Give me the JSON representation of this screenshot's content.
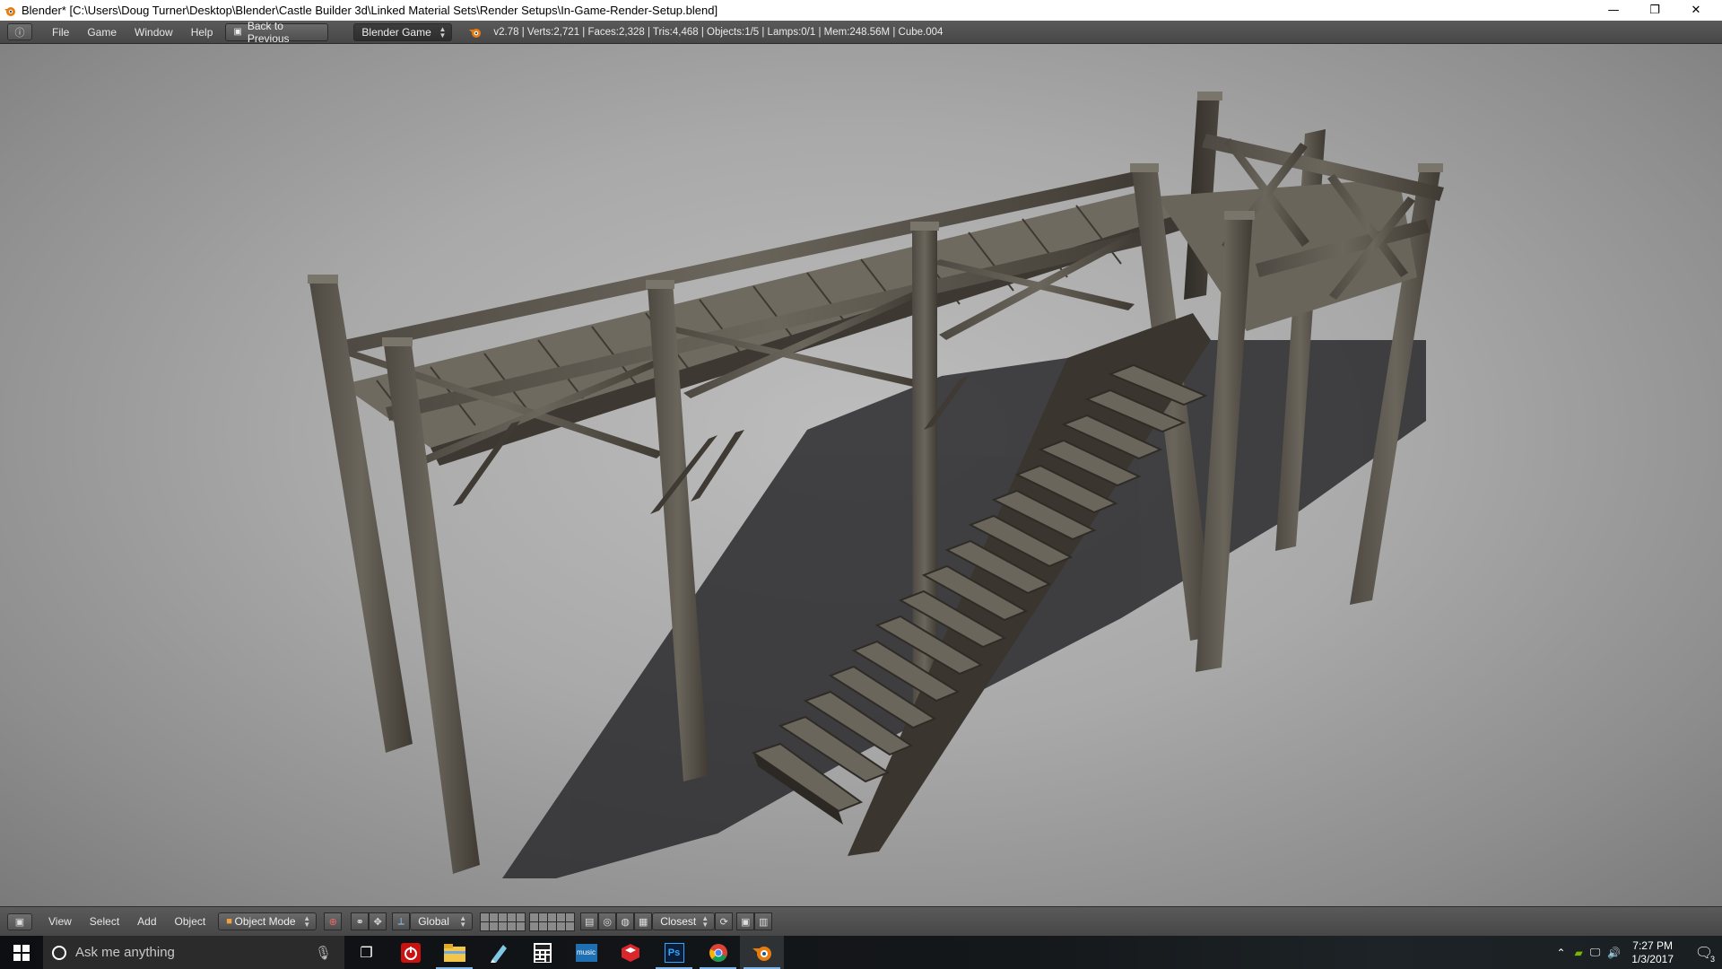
{
  "window": {
    "title": "Blender* [C:\\Users\\Doug Turner\\Desktop\\Blender\\Castle Builder 3d\\Linked Material Sets\\Render Setups\\In-Game-Render-Setup.blend]",
    "minimize_glyph": "—",
    "maximize_glyph": "❐",
    "close_glyph": "✕"
  },
  "info_header": {
    "menus": [
      "File",
      "Game",
      "Window",
      "Help"
    ],
    "back_button": "Back to Previous",
    "engine": "Blender Game",
    "stats": "v2.78 | Verts:2,721 | Faces:2,328 | Tris:4,468 | Objects:1/5 | Lamps:0/1 | Mem:248.56M | Cube.004"
  },
  "viewport": {
    "object": "wooden-walkway-with-stairs",
    "background_color": "#a9a9a9",
    "wood_color": "#5a554c"
  },
  "view_header": {
    "menus": [
      "View",
      "Select",
      "Add",
      "Object"
    ],
    "mode": "Object Mode",
    "orientation": "Global",
    "snap_target": "Closest"
  },
  "taskbar": {
    "search_placeholder": "Ask me anything",
    "apps": [
      "task-view",
      "power",
      "file-explorer",
      "notes",
      "calculator",
      "music",
      "sketchup",
      "photoshop",
      "chrome",
      "blender"
    ],
    "photoshop_label": "Ps",
    "music_label": "music",
    "time": "7:27 PM",
    "date": "1/3/2017",
    "notifications_count": "3"
  }
}
